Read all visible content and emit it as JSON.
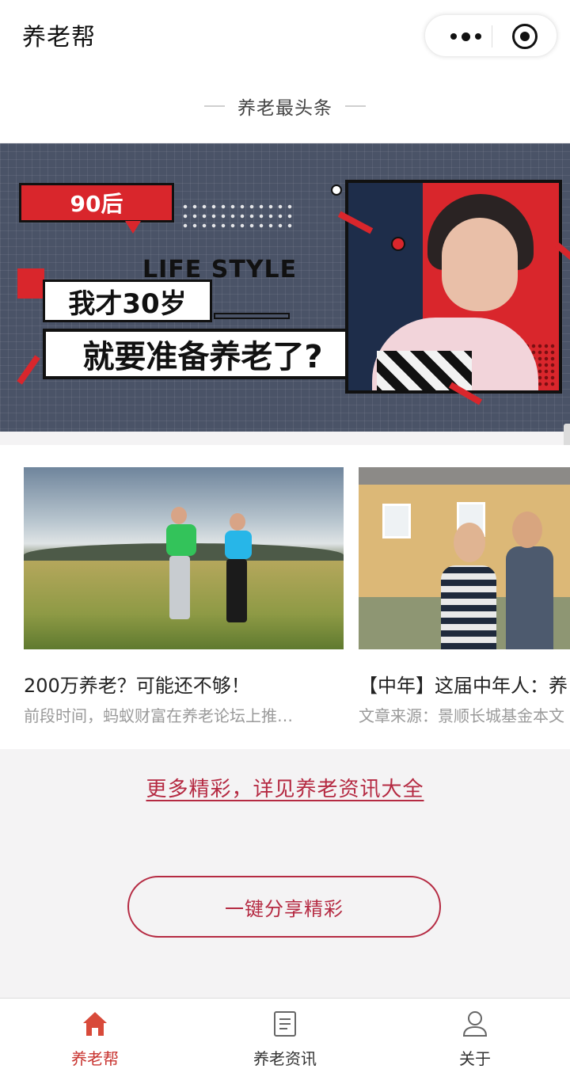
{
  "app": {
    "title": "养老帮"
  },
  "capsule": {
    "menu_icon": "more-dots-icon",
    "close_icon": "target-circle-icon"
  },
  "section": {
    "title": "养老最头条"
  },
  "banner": {
    "bubble": "90后",
    "tagline": "LIFE STYLE",
    "line1": "我才30岁",
    "line2": "就要准备养老了?"
  },
  "articles": [
    {
      "title": "200万养老？可能还不够！",
      "desc": "前段时间，蚂蚁财富在养老论坛上推…"
    },
    {
      "title": "【中年】这届中年人：养",
      "desc": "文章来源：景顺长城基金本文"
    }
  ],
  "more_link": "更多精彩，详见养老资讯大全",
  "share_button": "一键分享精彩",
  "tabs": [
    {
      "label": "养老帮",
      "icon": "home-icon",
      "active": true
    },
    {
      "label": "养老资讯",
      "icon": "document-icon",
      "active": false
    },
    {
      "label": "关于",
      "icon": "user-icon",
      "active": false
    }
  ],
  "colors": {
    "accent": "#b52a42",
    "tab_active": "#c8332f",
    "banner_bg": "#4a5367",
    "banner_red": "#d9262c"
  }
}
